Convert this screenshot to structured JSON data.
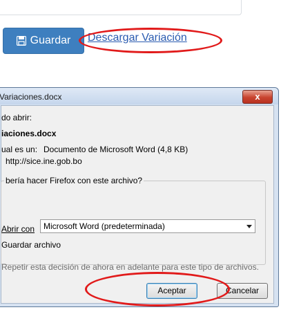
{
  "form": {
    "save_label": "Guardar",
    "download_link": "Descargar Variación"
  },
  "dialog": {
    "title": "Variaciones.docx",
    "heading": "do abrir:",
    "filename": "iaciones.docx",
    "type_label": "ual es un:",
    "type_value": "Documento de Microsoft Word (4,8 KB)",
    "source_value": "http://sice.ine.gob.bo",
    "question": "bería hacer Firefox con este archivo?",
    "open_with_label": "Abrir con",
    "open_with_app": "Microsoft Word (predeterminada)",
    "save_file_label": "Guardar archivo",
    "remember_label": "Repetir esta decisión de ahora en adelante para este tipo de archivos.",
    "ok_label": "Aceptar",
    "cancel_label": "Cancelar",
    "close_glyph": "x"
  },
  "annotations": {
    "highlight_color": "#e11a1a"
  }
}
